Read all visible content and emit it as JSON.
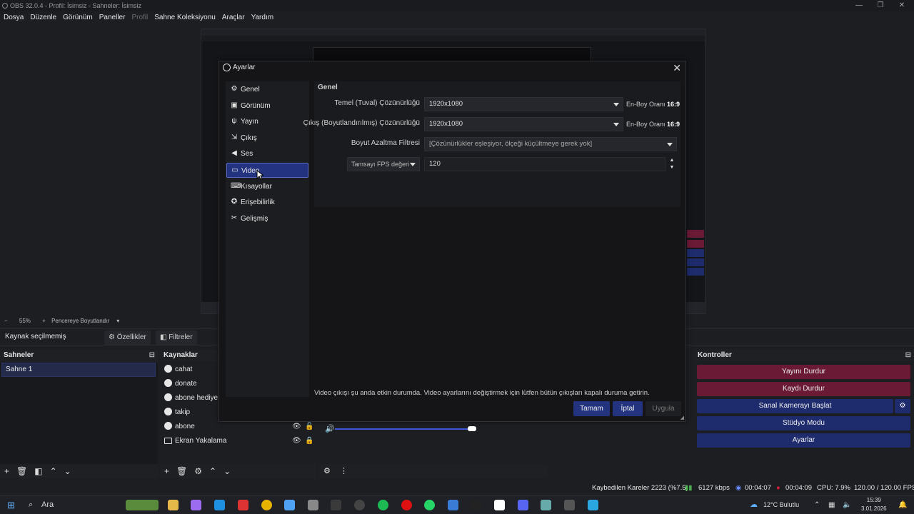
{
  "window": {
    "title": "OBS 32.0.4 - Profil: İsimsiz - Sahneler: İsimsiz",
    "minimize": "—",
    "maximize": "❐",
    "close": "✕"
  },
  "menu": [
    "Dosya",
    "Düzenle",
    "Görünüm",
    "Paneller",
    "Profil",
    "Sahne Koleksiyonu",
    "Araçlar",
    "Yardım"
  ],
  "zoom": {
    "minus": "−",
    "value": "55%",
    "plus": "+",
    "mode": "Pencereye Boyutlandır"
  },
  "source_bar": {
    "none_selected": "Kaynak seçilmemiş",
    "properties": "Özellikler",
    "filters": "Filtreler"
  },
  "scenes": {
    "title": "Sahneler",
    "items": [
      "Sahne 1"
    ]
  },
  "sources": {
    "title": "Kaynaklar",
    "items": [
      "cahat",
      "donate",
      "abone hediye",
      "takip",
      "abone",
      "Ekran Yakalama"
    ]
  },
  "controls": {
    "title": "Kontroller",
    "buttons": [
      "Yayını Durdur",
      "Kaydı Durdur",
      "Sanal Kamerayı Başlat",
      "Stüdyo Modu",
      "Ayarlar"
    ]
  },
  "status": {
    "dropped": "Kaybedilen Kareler 2223 (%7.5)",
    "bitrate": "6127 kbps",
    "stream_time": "00:04:07",
    "rec_time": "00:04:09",
    "cpu": "CPU: 7.9%",
    "fps": "120.00 / 120.00 FPS"
  },
  "taskbar": {
    "search": "Ara",
    "weather": "12°C Bulutlu",
    "time": "15:39",
    "date": "3.01.2026"
  },
  "settings": {
    "title": "Ayarlar",
    "close": "✕",
    "nav": [
      {
        "label": "Genel",
        "icon": "gear-icon"
      },
      {
        "label": "Görünüm",
        "icon": "palette-icon"
      },
      {
        "label": "Yayın",
        "icon": "antenna-icon"
      },
      {
        "label": "Çıkış",
        "icon": "output-icon"
      },
      {
        "label": "Ses",
        "icon": "speaker-icon"
      },
      {
        "label": "Video",
        "icon": "monitor-icon"
      },
      {
        "label": "Kısayollar",
        "icon": "keyboard-icon"
      },
      {
        "label": "Erişebilirlik",
        "icon": "accessibility-icon"
      },
      {
        "label": "Gelişmiş",
        "icon": "tools-icon"
      }
    ],
    "active_nav": "Video",
    "section": "Genel",
    "base_label": "Temel (Tuval) Çözünürlüğü",
    "base_value": "1920x1080",
    "output_label": "Çıkış (Boyutlandırılmış) Çözünürlüğü",
    "output_value": "1920x1080",
    "aspect_label": "En-Boy Oranı",
    "aspect_value": "16:9",
    "filter_label": "Boyut Azaltma Filtresi",
    "filter_value": "[Çözünürlükler eşleşiyor, ölçeği küçültmeye gerek yok]",
    "fps_type": "Tamsayı FPS değeri",
    "fps_value": "120",
    "warning": "Video çıkışı şu anda etkin durumda. Video ayarlarını değiştirmek için lütfen bütün çıkışları kapalı duruma getirin.",
    "ok": "Tamam",
    "cancel": "İptal",
    "apply": "Uygula"
  },
  "colors": {
    "accent": "#233380",
    "danger": "#6b1a35",
    "control_blue": "#1e2c6e"
  }
}
